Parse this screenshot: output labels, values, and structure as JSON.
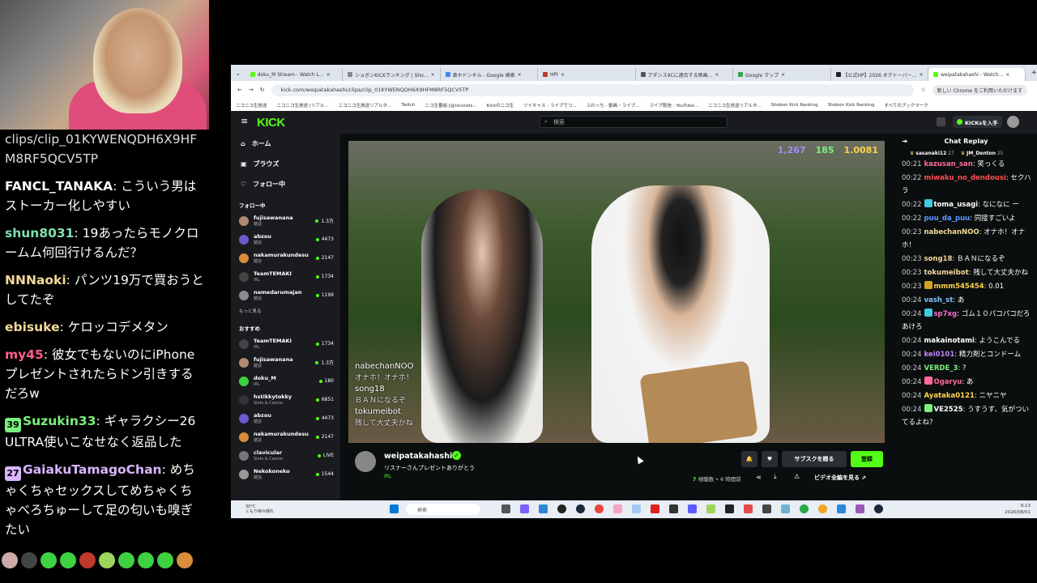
{
  "left_chat": {
    "messages": [
      {
        "user": "",
        "text": "clips/clip_01KYWENQDH6X9HFM8RF5QCV5TP",
        "user_color": "#ffffff"
      },
      {
        "user": "FANCL_TANAKA",
        "text": "こういう男はストーカー化しやすい",
        "user_color": "#ffffff"
      },
      {
        "user": "shun8031",
        "text": "19あったらモノクロームム何回行けるんだ？",
        "user_color": "#7ee0b0"
      },
      {
        "user": "NNNaoki",
        "text": "パンツ19万で買おうとしてたぞ",
        "user_color": "#f3d99a"
      },
      {
        "user": "ebisuke",
        "text": "ケロッコデメタン",
        "user_color": "#f3d99a"
      },
      {
        "user": "my45",
        "text": "彼女でもないのにiPhoneプレゼントされたらドン引きするだろw",
        "user_color": "#ff5f8a"
      },
      {
        "user": "Suzukin33",
        "text": "ギャラクシー26ULTRA使いこなせなく返品した",
        "user_color": "#7cf07c",
        "badge": "39"
      },
      {
        "user": "GaiakuTamagoChan",
        "text": "めちゃくちゃセックスしてめちゃくちゃべろちゅーして足の匂いも嗅ぎたい",
        "user_color": "#d8b5ff",
        "badge": "27"
      }
    ]
  },
  "browser": {
    "tabs": [
      {
        "title": "doku_M Stream - Watch L...",
        "color": "#53fc18"
      },
      {
        "title": "ショボンKICKランキング | Sho...",
        "color": "#888888"
      },
      {
        "title": "鼻ホドンキル - Google 検索",
        "color": "#4285f4"
      },
      {
        "title": "HPI",
        "color": "#c0392b"
      },
      {
        "title": "アダシス9Cに適合する映画...",
        "color": "#555555"
      },
      {
        "title": "Google マップ",
        "color": "#34a853"
      },
      {
        "title": "【公式HP】2026 オクトーバー...",
        "color": "#222222"
      },
      {
        "title": "weipatakahashi - Watch...",
        "color": "#53fc18"
      }
    ],
    "url": "kick.com/weipatakahashi/clips/clip_01KYWENQDH6X9HFM8RF5QCV5TP",
    "chrome_notice": "新しい Chrome をご利用いただけます",
    "bookmarks": [
      "ニコニコ生放送",
      "ニコニコ生放送 (リアル...",
      "ニコニコ生放送リアルタ...",
      "Twitch",
      "ニコ生番組 [@nicorats...",
      "Kickのニコ生",
      "ツイキャス - ライブでつ...",
      "ふわっち - 動画・ライブ...",
      "ライブ配信 - YouTube...",
      "ニコニコ生放送リアルタ...",
      "Shobon Kick Ranking",
      "Shobon Kick Ranking",
      "すべてのブックマーク"
    ]
  },
  "kick": {
    "logo": "KICK",
    "search_placeholder": "検索",
    "kicks_button": "KICKsを入手",
    "nav": [
      {
        "label": "ホーム",
        "icon": "home-icon"
      },
      {
        "label": "ブラウズ",
        "icon": "browse-icon"
      },
      {
        "label": "フォロー中",
        "icon": "heart-icon"
      }
    ],
    "following_head": "フォロー中",
    "following": [
      {
        "name": "fujisawanana",
        "cat": "雑談",
        "viewers": "1.3万"
      },
      {
        "name": "abzou",
        "cat": "雑談",
        "viewers": "4473"
      },
      {
        "name": "nakamurakundesu",
        "cat": "雑談",
        "viewers": "2147"
      },
      {
        "name": "TeamTEMAKI",
        "cat": "IRL",
        "viewers": "1734"
      },
      {
        "name": "namedarumajan",
        "cat": "雑談",
        "viewers": "1199"
      }
    ],
    "show_more": "もっと見る",
    "recommended_head": "おすすめ",
    "recommended": [
      {
        "name": "TeamTEMAKI",
        "cat": "IRL",
        "viewers": "1734"
      },
      {
        "name": "fujisawanana",
        "cat": "雑談",
        "viewers": "1.3万"
      },
      {
        "name": "doku_M",
        "cat": "IRL",
        "viewers": "180"
      },
      {
        "name": "hstikkytokky",
        "cat": "Slots & Casino",
        "viewers": "6851"
      },
      {
        "name": "abzou",
        "cat": "雑談",
        "viewers": "4473"
      },
      {
        "name": "nakamurakundesu",
        "cat": "雑談",
        "viewers": "2147"
      },
      {
        "name": "clavicular",
        "cat": "Slots & Casino",
        "viewers": "LIVE"
      },
      {
        "name": "Nekokoneko",
        "cat": "雑談",
        "viewers": "1544"
      }
    ],
    "video_stats": [
      "1,267",
      "185",
      "1.0081"
    ],
    "video_overlay": [
      {
        "user": "nabechanNOO",
        "text": "オナホ！オナホ！"
      },
      {
        "user": "song18",
        "text": "ＢＡＮになるぞ"
      },
      {
        "user": "tokumeibot",
        "text": "残して大丈夫かね"
      }
    ],
    "streamer": "weipatakahashi",
    "stream_title": "リスナーさんプレゼントありがとう",
    "category": "IRL",
    "subscribe_label": "サブスクを贈る",
    "follow_label": "登録",
    "viewers_count": "7",
    "viewers_label": "視聴数",
    "time_ago": "6 時間前",
    "watch_full": "ビデオ全編を見る"
  },
  "chat": {
    "title": "Chat Replay",
    "pinned": [
      {
        "name": "sasanaki12",
        "count": "27"
      },
      {
        "name": "JM_Denton",
        "count": "25"
      }
    ],
    "messages": [
      {
        "t": "00:21",
        "user": "kazusan_san",
        "text": "笑っくる",
        "color": "#ff6b9a"
      },
      {
        "t": "00:22",
        "user": "miwaku_no_dendousi",
        "text": "セクハラ",
        "color": "#ff4d4d"
      },
      {
        "t": "00:22",
        "user": "toma_usagi",
        "text": "なになに ー",
        "color": "#ffffff",
        "badge": "#42c8e0"
      },
      {
        "t": "00:22",
        "user": "puu_da_puu",
        "text": "同接すごいよ",
        "color": "#5b9bff"
      },
      {
        "t": "00:23",
        "user": "nabechanNOO",
        "text": "オナホ！オナホ！",
        "color": "#f3d99a"
      },
      {
        "t": "00:23",
        "user": "song18",
        "text": "ＢＡＮになるぞ",
        "color": "#f3d99a"
      },
      {
        "t": "00:23",
        "user": "tokumeibot",
        "text": "残して大丈夫かね",
        "color": "#f3d99a"
      },
      {
        "t": "00:23",
        "user": "mmm545454",
        "text": "0.01",
        "color": "#ffd34d",
        "badge": "#d1a226"
      },
      {
        "t": "00:24",
        "user": "vash_st",
        "text": "あ",
        "color": "#7ec8ff"
      },
      {
        "t": "00:24",
        "user": "sp7xg",
        "text": "ゴム１０パコパコだろあけろ",
        "color": "#ff6bd0",
        "badge": "#42c8e0"
      },
      {
        "t": "00:24",
        "user": "makainotami",
        "text": "ようこんでる",
        "color": "#ffffff"
      },
      {
        "t": "00:24",
        "user": "kei0101",
        "text": "精力剤とコンドーム",
        "color": "#c08aff"
      },
      {
        "t": "00:24",
        "user": "VERDE_3",
        "text": "?",
        "color": "#7cf07c"
      },
      {
        "t": "00:24",
        "user": "Ogaryu",
        "text": "あ",
        "color": "#ff6b9a",
        "badge": "#ff6b9a"
      },
      {
        "t": "00:24",
        "user": "Ayataka0121",
        "text": "ニヤニヤ",
        "color": "#ffd34d"
      },
      {
        "t": "00:24",
        "user": "VE2525",
        "text": "うすうす、気がついてるよね？",
        "color": "#ffffff",
        "badge": "#7cf07c"
      }
    ]
  },
  "taskbar": {
    "weather": "30°C",
    "weather_sub": "くもり時々晴れ",
    "search": "検索",
    "time": "9:13",
    "date": "2026/08/01"
  }
}
